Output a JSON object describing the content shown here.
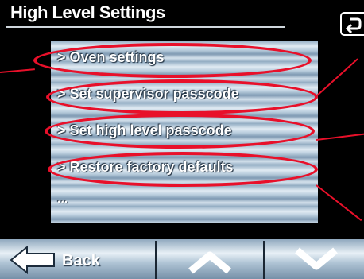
{
  "header": {
    "title": "High Level Settings",
    "back_icon": "return-arrow-icon"
  },
  "menu": {
    "items": [
      {
        "label": "> Oven settings"
      },
      {
        "label": "> Set supervisor passcode"
      },
      {
        "label": "> Set high level passcode"
      },
      {
        "label": "> Restore factory defaults"
      },
      {
        "label": "..."
      }
    ]
  },
  "footer": {
    "back_label": "Back",
    "back_icon": "left-arrow-icon",
    "up_icon": "chevron-up-icon",
    "down_icon": "chevron-down-icon"
  },
  "colors": {
    "highlight": "#e8102a",
    "panel": "#b9cddd",
    "background": "#000000"
  }
}
